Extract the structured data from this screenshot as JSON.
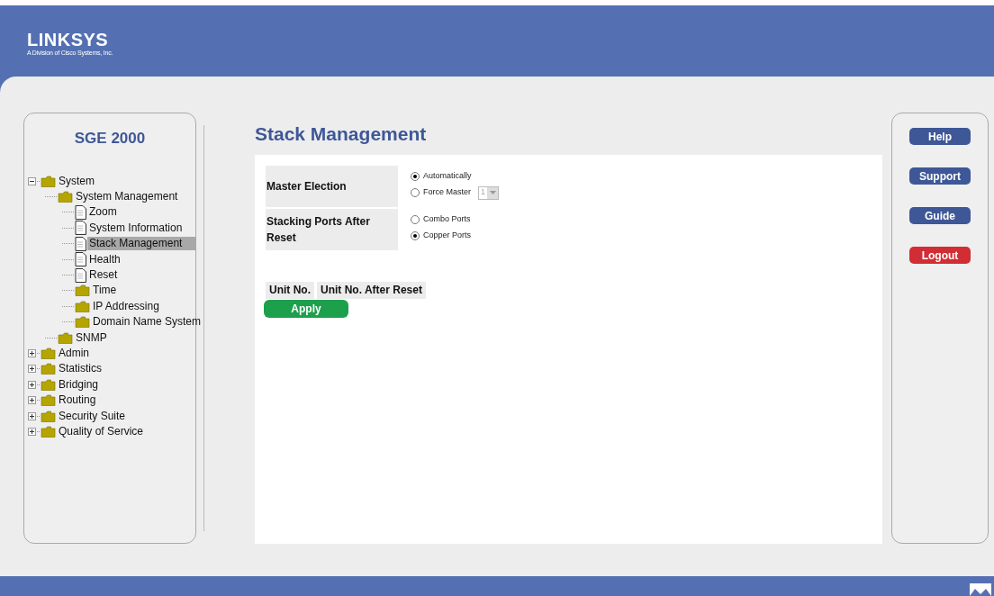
{
  "header": {
    "logo": "LINKSYS",
    "logo_tagline": "A Division of Cisco Systems, Inc."
  },
  "sidebar": {
    "title": "SGE 2000",
    "tree": [
      {
        "label": "System",
        "kind": "folder",
        "expanded": true,
        "selected": false,
        "children": [
          {
            "label": "System Management",
            "kind": "folder",
            "selected": false,
            "children": [
              {
                "label": "Zoom",
                "kind": "page",
                "selected": false
              },
              {
                "label": "System Information",
                "kind": "page",
                "selected": false
              },
              {
                "label": "Stack Management",
                "kind": "page",
                "selected": true
              },
              {
                "label": "Health",
                "kind": "page",
                "selected": false
              },
              {
                "label": "Reset",
                "kind": "page",
                "selected": false
              },
              {
                "label": "Time",
                "kind": "folder",
                "selected": false
              },
              {
                "label": "IP Addressing",
                "kind": "folder",
                "selected": false
              },
              {
                "label": "Domain Name System",
                "kind": "folder",
                "selected": false
              }
            ]
          },
          {
            "label": "SNMP",
            "kind": "folder",
            "selected": false
          }
        ]
      },
      {
        "label": "Admin",
        "kind": "folder",
        "expanded": false,
        "selected": false
      },
      {
        "label": "Statistics",
        "kind": "folder",
        "expanded": false,
        "selected": false
      },
      {
        "label": "Bridging",
        "kind": "folder",
        "expanded": false,
        "selected": false
      },
      {
        "label": "Routing",
        "kind": "folder",
        "expanded": false,
        "selected": false
      },
      {
        "label": "Security Suite",
        "kind": "folder",
        "expanded": false,
        "selected": false
      },
      {
        "label": "Quality of Service",
        "kind": "folder",
        "expanded": false,
        "selected": false
      }
    ]
  },
  "page": {
    "title": "Stack Management",
    "fields": [
      {
        "label": "Master Election",
        "options": [
          {
            "label": "Automatically",
            "selected": true
          },
          {
            "label": "Force Master",
            "selected": false,
            "select": {
              "value": "1",
              "disabled": true
            }
          }
        ]
      },
      {
        "label": "Stacking Ports After Reset",
        "options": [
          {
            "label": "Combo Ports",
            "selected": false
          },
          {
            "label": "Copper Ports",
            "selected": true
          }
        ]
      }
    ],
    "table": {
      "columns": [
        "Unit No.",
        "Unit No. After Reset"
      ]
    },
    "apply": "Apply"
  },
  "side_buttons": [
    {
      "label": "Help",
      "kind": "normal"
    },
    {
      "label": "Support",
      "kind": "normal"
    },
    {
      "label": "Guide",
      "kind": "normal"
    },
    {
      "label": "Logout",
      "kind": "danger"
    }
  ]
}
